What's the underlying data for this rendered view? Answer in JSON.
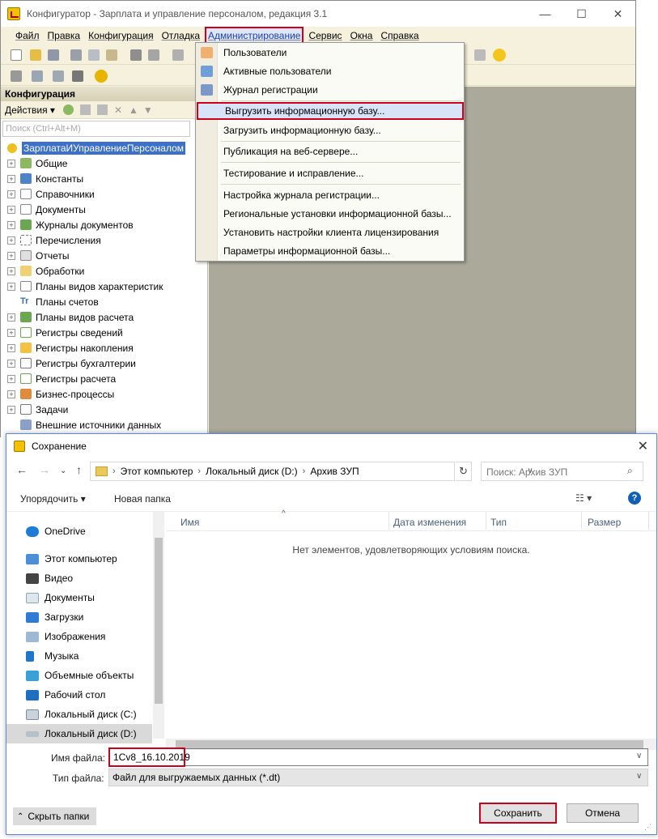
{
  "app": {
    "title": "Конфигуратор - Зарплата и управление персоналом, редакция 3.1",
    "menu": [
      "Файл",
      "Правка",
      "Конфигурация",
      "Отладка",
      "Администрирование",
      "Сервис",
      "Окна",
      "Справка"
    ]
  },
  "config_panel": {
    "title": "Конфигурация",
    "actions": "Действия ▾",
    "search_placeholder": "Поиск (Ctrl+Alt+M)",
    "root": "ЗарплатаИУправлениеПерсоналом",
    "items": [
      "Общие",
      "Константы",
      "Справочники",
      "Документы",
      "Журналы документов",
      "Перечисления",
      "Отчеты",
      "Обработки",
      "Планы видов характеристик",
      "Планы счетов",
      "Планы видов расчета",
      "Регистры сведений",
      "Регистры накопления",
      "Регистры бухгалтерии",
      "Регистры расчета",
      "Бизнес-процессы",
      "Задачи",
      "Внешние источники данных"
    ]
  },
  "admin_menu": {
    "items": [
      "Пользователи",
      "Активные пользователи",
      "Журнал регистрации",
      "Выгрузить информационную базу...",
      "Загрузить информационную базу...",
      "Публикация на веб-сервере...",
      "Тестирование и исправление...",
      "Настройка журнала регистрации...",
      "Региональные установки информационной базы...",
      "Установить настройки клиента лицензирования",
      "Параметры информационной базы..."
    ]
  },
  "save_dialog": {
    "title": "Сохранение",
    "address": [
      "Этот компьютер",
      "Локальный диск (D:)",
      "Архив ЗУП"
    ],
    "search_placeholder": "Поиск: Архив ЗУП",
    "organize": "Упорядочить ▾",
    "new_folder": "Новая папка",
    "nav": [
      "OneDrive",
      "Этот компьютер",
      "Видео",
      "Документы",
      "Загрузки",
      "Изображения",
      "Музыка",
      "Объемные объекты",
      "Рабочий стол",
      "Локальный диск (C:)",
      "Локальный диск (D:)"
    ],
    "columns": [
      "Имя",
      "Дата изменения",
      "Тип",
      "Размер"
    ],
    "empty_message": "Нет элементов, удовлетворяющих условиям поиска.",
    "filename_label": "Имя файла:",
    "filename_value": "1Cv8_16.10.2019",
    "filetype_label": "Тип файла:",
    "filetype_value": "Файл для выгружаемых данных (*.dt)",
    "hide_folders": "Скрыть папки",
    "save": "Сохранить",
    "cancel": "Отмена"
  },
  "colors": {
    "highlight": "#d0001c",
    "selection": "#3d70c9",
    "accent_blue": "#1160b8"
  }
}
